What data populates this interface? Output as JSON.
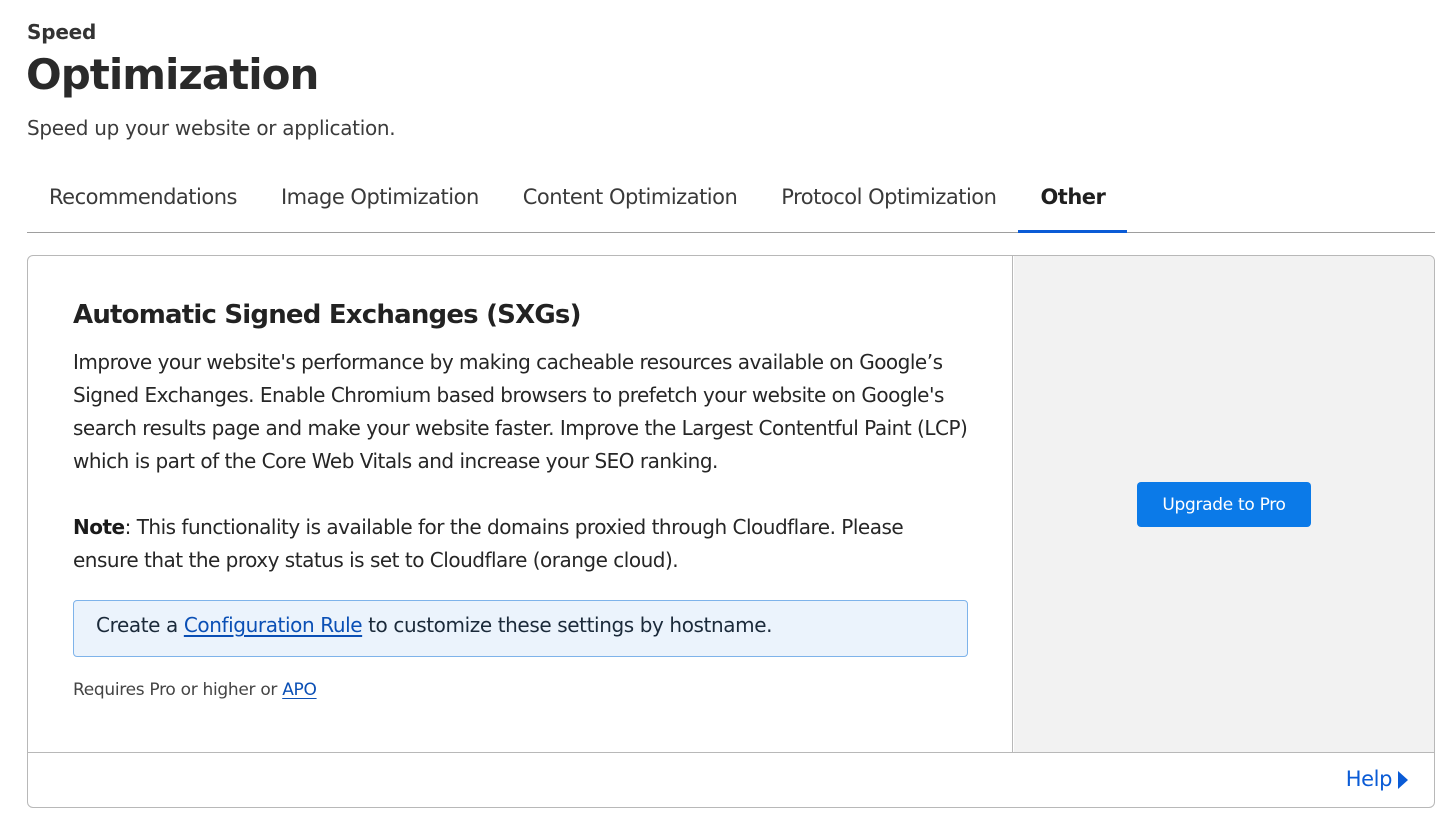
{
  "header": {
    "eyebrow": "Speed",
    "title": "Optimization",
    "subtitle": "Speed up your website or application."
  },
  "tabs": [
    {
      "label": "Recommendations",
      "active": false
    },
    {
      "label": "Image Optimization",
      "active": false
    },
    {
      "label": "Content Optimization",
      "active": false
    },
    {
      "label": "Protocol Optimization",
      "active": false
    },
    {
      "label": "Other",
      "active": true
    }
  ],
  "setting": {
    "title": "Automatic Signed Exchanges (SXGs)",
    "description": "Improve your website's performance by making cacheable resources available on Google’s Signed Exchanges. Enable Chromium based browsers to prefetch your website on Google's search results page and make your website faster. Improve the Largest Contentful Paint (LCP) which is part of the Core Web Vitals and increase your SEO ranking.",
    "note_label": "Note",
    "note_text": ": This functionality is available for the domains proxied through Cloudflare. Please ensure that the proxy status is set to Cloudflare (orange cloud).",
    "info_prefix": "Create a ",
    "info_link": "Configuration Rule",
    "info_suffix": " to customize these settings by hostname.",
    "requires_text": "Requires Pro or higher or ",
    "requires_link": "APO"
  },
  "side": {
    "button_label": "Upgrade to Pro"
  },
  "footer": {
    "help_label": "Help",
    "help_icon": "caret-right-icon"
  },
  "colors": {
    "accent": "#0a5bd6",
    "button": "#0b7ae8",
    "info_bg": "#ebf3fc",
    "info_border": "#7eb3ea",
    "side_bg": "#f2f2f2"
  }
}
